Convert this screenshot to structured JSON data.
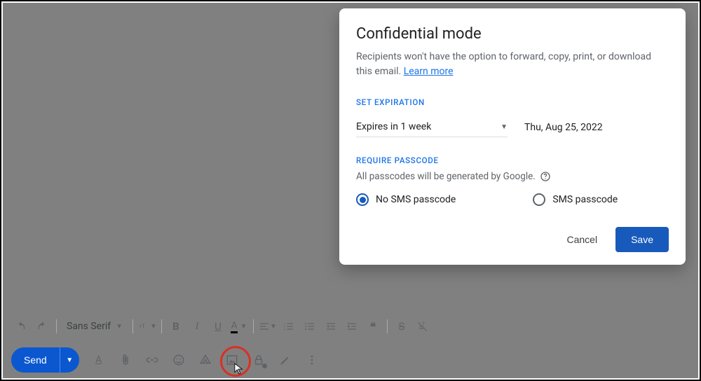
{
  "dialog": {
    "title": "Confidential mode",
    "description_pre": "Recipients won't have the option to forward, copy, print, or download this email. ",
    "learn_more": "Learn more",
    "section_expiration_label": "SET EXPIRATION",
    "expiration_select_value": "Expires in 1 week",
    "expiration_date": "Thu, Aug 25, 2022",
    "section_passcode_label": "REQUIRE PASSCODE",
    "passcode_hint": "All passcodes will be generated by Google.",
    "radio_no_sms": "No SMS passcode",
    "radio_sms": "SMS passcode",
    "cancel": "Cancel",
    "save": "Save"
  },
  "toolbar": {
    "font": "Sans Serif"
  },
  "actionbar": {
    "send": "Send"
  }
}
